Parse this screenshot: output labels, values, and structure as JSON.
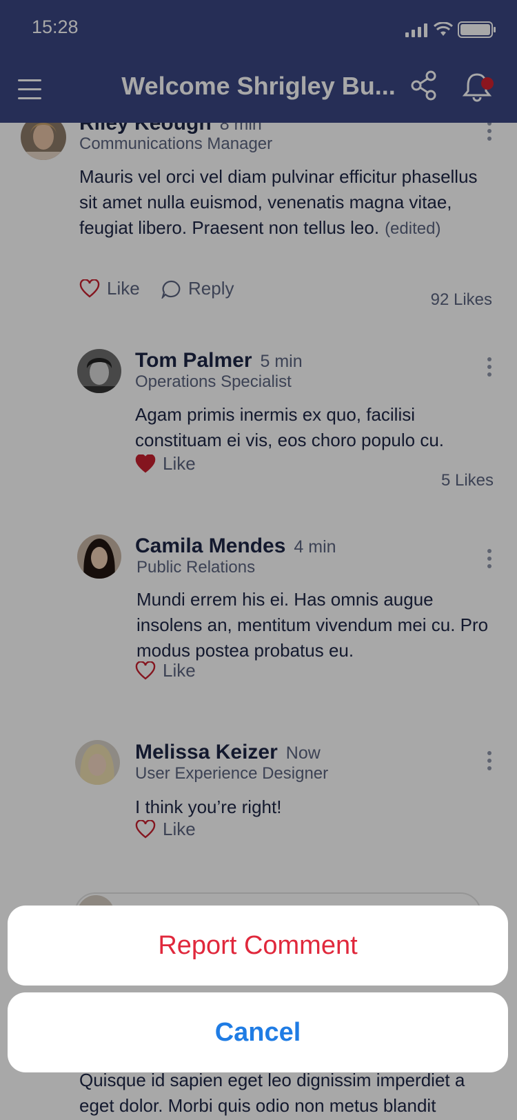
{
  "status_bar": {
    "time": "15:28"
  },
  "header": {
    "title": "Welcome Shrigley Bu..."
  },
  "comments": [
    {
      "name": "Riley Keough",
      "time": "8 min",
      "role": "Communications Manager",
      "text": "Mauris vel orci vel diam pulvinar efficitur phasellus sit amet nulla euismod, venenatis magna vitae, feugiat libero. Praesent non tellus leo.",
      "edited": "(edited)",
      "like_label": "Like",
      "reply_label": "Reply",
      "likes": "92 Likes",
      "liked": false
    },
    {
      "name": "Tom Palmer",
      "time": "5 min",
      "role": "Operations Specialist",
      "text": "Agam primis inermis ex quo, facilisi constituam ei vis, eos choro populo cu.",
      "like_label": "Like",
      "likes": "5 Likes",
      "liked": true
    },
    {
      "name": "Camila Mendes",
      "time": "4 min",
      "role": "Public Relations",
      "text": "Mundi errem his ei. Has omnis augue insolens an, mentitum vivendum mei cu. Pro modus postea probatus eu.",
      "like_label": "Like",
      "liked": false
    },
    {
      "name": "Melissa Keizer",
      "time": "Now",
      "role": "User Experience Designer",
      "text": "I think you’re right!",
      "like_label": "Like",
      "liked": false
    }
  ],
  "bottom_text": "Quisque id sapien eget leo dignissim imperdiet a eget dolor. Morbi quis odio non metus blandit",
  "action_sheet": {
    "report_label": "Report Comment",
    "cancel_label": "Cancel"
  },
  "colors": {
    "header_bg": "#3a4683",
    "like_red": "#c8202f",
    "report_red": "#e0283c",
    "cancel_blue": "#1f7ce4",
    "notification_dot": "#d3222f"
  },
  "icons": [
    "hamburger-icon",
    "share-icon",
    "bell-icon",
    "heart-icon",
    "reply-bubble-icon",
    "kebab-icon",
    "signal-icon",
    "wifi-icon",
    "battery-icon"
  ]
}
